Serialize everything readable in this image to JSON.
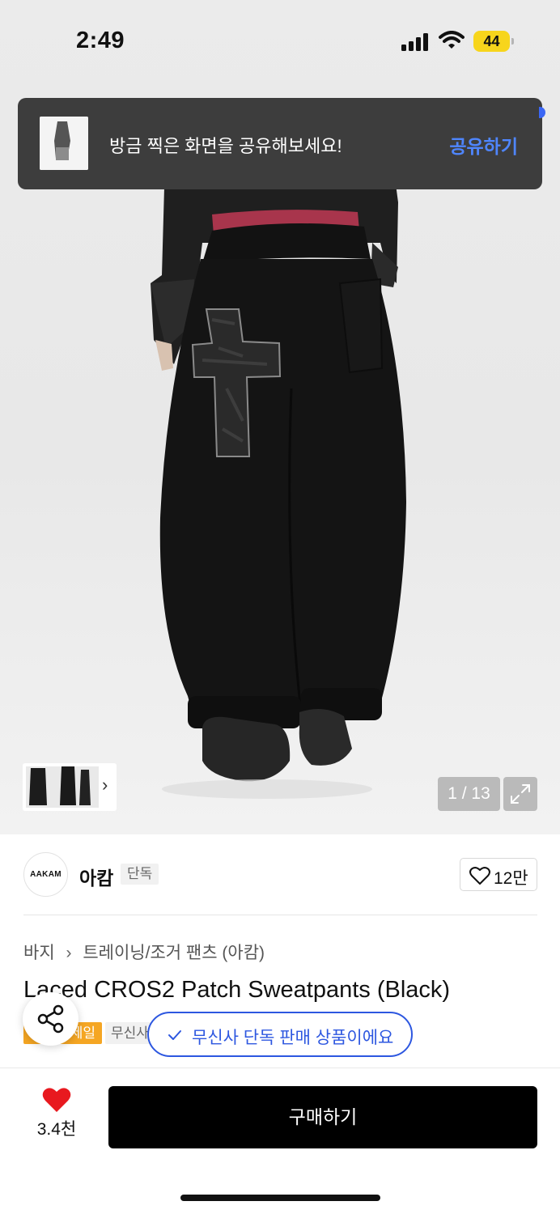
{
  "status_bar": {
    "time": "2:49",
    "battery": "44"
  },
  "toast": {
    "message": "방금 찍은 화면을 공유해보세요!",
    "action": "공유하기"
  },
  "gallery": {
    "counter": "1 / 13"
  },
  "brand": {
    "logo_text": "AAKAM",
    "name": "아캄",
    "badge": "단독",
    "likes": "12만"
  },
  "product": {
    "breadcrumb": [
      "바지",
      "트레이닝/조거 팬츠 (아캄)"
    ],
    "title": "Laced CROS2 Patch Sweatpants (Black)",
    "tags": {
      "sale": "세일",
      "exclusive": "무신사 단독"
    },
    "exclusive_notice": "무신사 단독 판매 상품이에요"
  },
  "bottom_bar": {
    "wishlist_count": "3.4천",
    "buy_label": "구매하기"
  },
  "colors": {
    "accent_blue": "#2d57e0",
    "sale_orange": "#f5a623",
    "heart_red": "#e8191f",
    "buy_black": "#000000",
    "battery_yellow": "#f7d51c"
  },
  "icons": [
    "signal-icon",
    "wifi-icon",
    "battery-icon",
    "chevron-right-icon",
    "expand-icon",
    "heart-outline-icon",
    "chevron-breadcrumb-icon",
    "share-icon",
    "check-icon",
    "heart-filled-icon"
  ]
}
